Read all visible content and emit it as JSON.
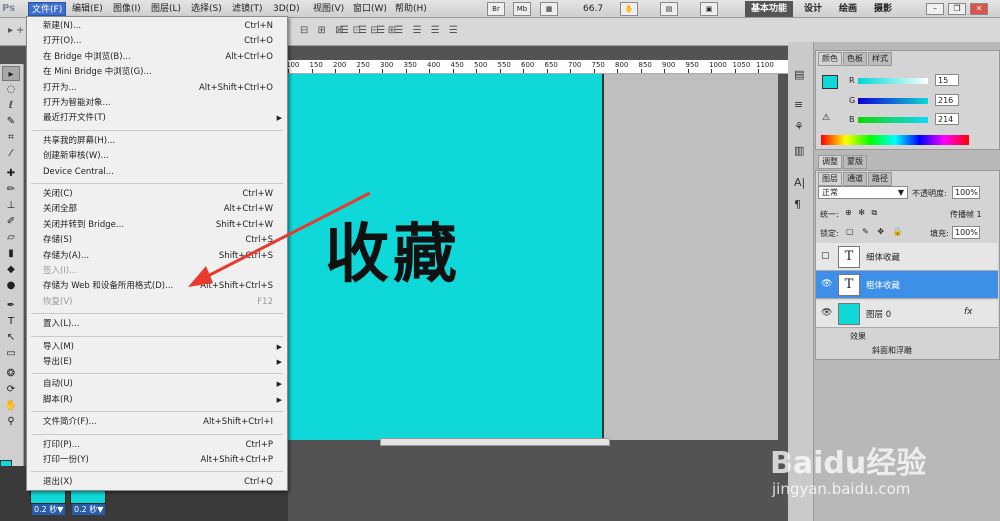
{
  "menubar": {
    "logo": "Ps",
    "items": [
      "文件(F)",
      "编辑(E)",
      "图像(I)",
      "图层(L)",
      "选择(S)",
      "滤镜(T)",
      "3D(D)",
      "视图(V)",
      "窗口(W)",
      "帮助(H)"
    ],
    "icons": [
      "Br",
      "Mb"
    ],
    "zoom": "66.7",
    "workspaces": [
      "基本功能",
      "设计",
      "绘画",
      "摄影"
    ]
  },
  "file_menu": {
    "items": [
      {
        "label": "新建(N)...",
        "shortcut": "Ctrl+N"
      },
      {
        "label": "打开(O)...",
        "shortcut": "Ctrl+O"
      },
      {
        "label": "在 Bridge 中浏览(B)...",
        "shortcut": "Alt+Ctrl+O"
      },
      {
        "label": "在 Mini Bridge 中浏览(G)...",
        "shortcut": ""
      },
      {
        "label": "打开为...",
        "shortcut": "Alt+Shift+Ctrl+O"
      },
      {
        "label": "打开为智能对象...",
        "shortcut": ""
      },
      {
        "label": "最近打开文件(T)",
        "shortcut": "",
        "submenu": true
      },
      {
        "sep": true
      },
      {
        "label": "共享我的屏幕(H)...",
        "shortcut": ""
      },
      {
        "label": "创建新审核(W)...",
        "shortcut": ""
      },
      {
        "label": "Device Central...",
        "shortcut": ""
      },
      {
        "sep": true
      },
      {
        "label": "关闭(C)",
        "shortcut": "Ctrl+W"
      },
      {
        "label": "关闭全部",
        "shortcut": "Alt+Ctrl+W"
      },
      {
        "label": "关闭并转到 Bridge...",
        "shortcut": "Shift+Ctrl+W"
      },
      {
        "label": "存储(S)",
        "shortcut": "Ctrl+S"
      },
      {
        "label": "存储为(A)...",
        "shortcut": "Shift+Ctrl+S"
      },
      {
        "label": "签入(I)...",
        "shortcut": "",
        "disabled": true
      },
      {
        "label": "存储为 Web 和设备所用格式(D)...",
        "shortcut": "Alt+Shift+Ctrl+S"
      },
      {
        "label": "恢复(V)",
        "shortcut": "F12",
        "disabled": true
      },
      {
        "sep": true
      },
      {
        "label": "置入(L)...",
        "shortcut": ""
      },
      {
        "sep": true
      },
      {
        "label": "导入(M)",
        "shortcut": "",
        "submenu": true
      },
      {
        "label": "导出(E)",
        "shortcut": "",
        "submenu": true
      },
      {
        "sep": true
      },
      {
        "label": "自动(U)",
        "shortcut": "",
        "submenu": true
      },
      {
        "label": "脚本(R)",
        "shortcut": "",
        "submenu": true
      },
      {
        "sep": true
      },
      {
        "label": "文件简介(F)...",
        "shortcut": "Alt+Shift+Ctrl+I"
      },
      {
        "sep": true
      },
      {
        "label": "打印(P)...",
        "shortcut": "Ctrl+P"
      },
      {
        "label": "打印一份(Y)",
        "shortcut": "Alt+Shift+Ctrl+P"
      },
      {
        "sep": true
      },
      {
        "label": "退出(X)",
        "shortcut": "Ctrl+Q"
      }
    ]
  },
  "ruler": {
    "ticks": [
      "100",
      "150",
      "200",
      "250",
      "300",
      "350",
      "400",
      "450",
      "500",
      "550",
      "600",
      "650",
      "700",
      "750",
      "800",
      "850",
      "900",
      "950",
      "1000",
      "1050",
      "1100"
    ]
  },
  "canvas": {
    "text": "收藏",
    "color": "#0ed8d8"
  },
  "timeline": {
    "frame_times": [
      "0.2 秒▼",
      "0.2 秒▼"
    ]
  },
  "color_panel": {
    "tabs": [
      "颜色",
      "色板",
      "样式"
    ],
    "r": "15",
    "g": "216",
    "b": "214",
    "labels": [
      "R",
      "G",
      "B"
    ]
  },
  "adjust_tabs": [
    "调整",
    "蒙版"
  ],
  "layers_panel": {
    "tabs": [
      "图层",
      "通道",
      "路径"
    ],
    "blend_mode": "正常",
    "opacity_label": "不透明度:",
    "opacity": "100%",
    "unify_label": "统一:",
    "propagate_label": "传播帧 1",
    "lock_label": "锁定:",
    "fill_label": "填充:",
    "fill": "100%",
    "layers": [
      {
        "name": "细体收藏",
        "thumb": "T"
      },
      {
        "name": "粗体收藏",
        "thumb": "T"
      },
      {
        "name": "图层 0",
        "thumb": ""
      }
    ],
    "effects_label": "效果",
    "effect_name": "斜面和浮雕",
    "fx": "fx"
  },
  "watermark": {
    "brand": "Baidu经验",
    "url": "jingyan.baidu.com"
  }
}
